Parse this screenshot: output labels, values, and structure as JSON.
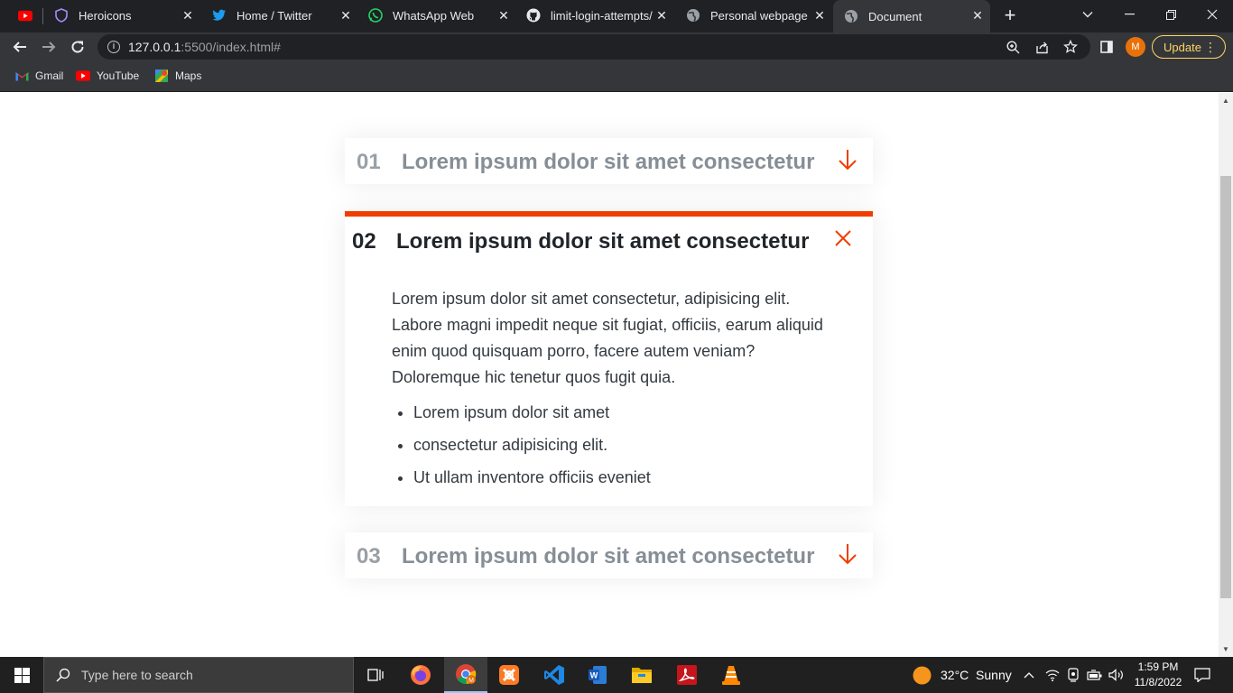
{
  "browser": {
    "tabs": [
      {
        "title": "",
        "icon": "youtube-icon"
      },
      {
        "title": "Heroicons",
        "icon": "heroicons-icon"
      },
      {
        "title": "Home / Twitter",
        "icon": "twitter-icon"
      },
      {
        "title": "WhatsApp Web",
        "icon": "whatsapp-icon"
      },
      {
        "title": "limit-login-attempts/",
        "icon": "github-icon"
      },
      {
        "title": "Personal webpage",
        "icon": "globe-icon"
      },
      {
        "title": "Document",
        "icon": "globe-icon",
        "active": true
      }
    ],
    "url_host": "127.0.0.1",
    "url_path": ":5500/index.html#",
    "profile_initial": "M",
    "update_label": "Update",
    "bookmarks": [
      {
        "label": "Gmail",
        "icon": "gmail-icon"
      },
      {
        "label": "YouTube",
        "icon": "youtube-icon"
      },
      {
        "label": "Maps",
        "icon": "maps-icon"
      }
    ]
  },
  "accordion": {
    "accent_color": "#f03e00",
    "items": [
      {
        "number": "01",
        "title": "Lorem ipsum dolor sit amet consectetur",
        "open": false
      },
      {
        "number": "02",
        "title": "Lorem ipsum dolor sit amet consectetur",
        "open": true,
        "text": "Lorem ipsum dolor sit amet consectetur, adipisicing elit. Labore magni impedit neque sit fugiat, officiis, earum aliquid enim quod quisquam porro, facere autem veniam? Doloremque hic tenetur quos fugit quia.",
        "list": [
          "Lorem ipsum dolor sit amet",
          "consectetur adipisicing elit.",
          "Ut ullam inventore officiis eveniet"
        ]
      },
      {
        "number": "03",
        "title": "Lorem ipsum dolor sit amet consectetur",
        "open": false
      }
    ]
  },
  "taskbar": {
    "search_placeholder": "Type here to search",
    "weather": "32°C  Sunny",
    "time": "1:59 PM",
    "date": "11/8/2022",
    "apps": [
      "task-view-icon",
      "firefox-icon",
      "chrome-icon",
      "xampp-icon",
      "vscode-icon",
      "word-icon",
      "file-explorer-icon",
      "acrobat-icon",
      "vlc-icon"
    ]
  }
}
